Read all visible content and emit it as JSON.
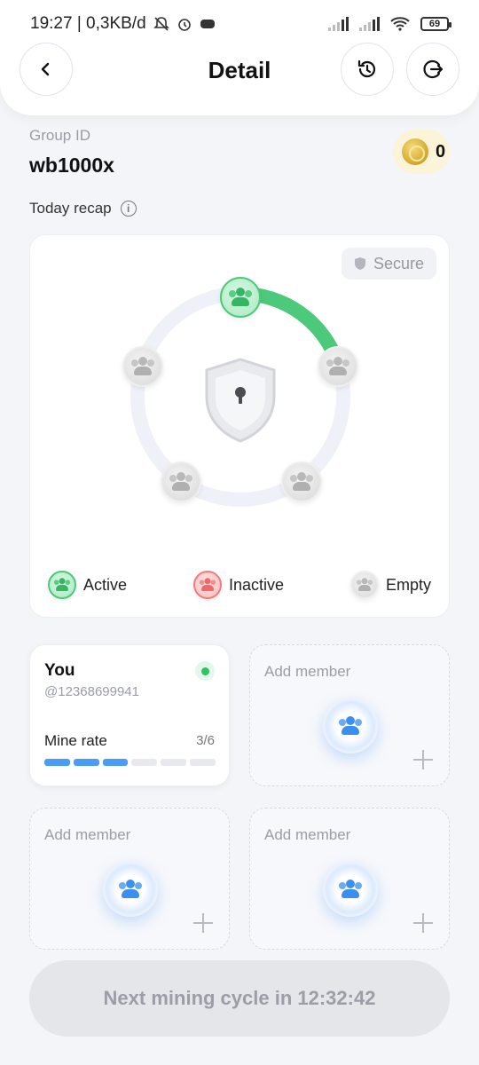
{
  "status_bar": {
    "time_net": "19:27 | 0,3KB/d",
    "battery": "69"
  },
  "header": {
    "title": "Detail",
    "back_icon": "chevron-left-icon",
    "history_icon": "history-icon",
    "exit_icon": "exit-icon"
  },
  "group": {
    "label": "Group ID",
    "id": "wb1000x",
    "coin_count": "0"
  },
  "recap": {
    "label": "Today recap",
    "secure_label": "Secure",
    "active_progress": 0.2,
    "legend": {
      "active": "Active",
      "inactive": "Inactive",
      "empty": "Empty"
    },
    "colors": {
      "active": "#4cc97a",
      "inactive": "#ef7d7d",
      "empty": "#d8d8d8",
      "ring": "#eef2f8"
    }
  },
  "you": {
    "name": "You",
    "handle": "@12368699941",
    "mine_label": "Mine rate",
    "mine_value": "3/6",
    "mine_filled": 3,
    "mine_total": 6
  },
  "members": {
    "add_label": "Add member"
  },
  "cycle": {
    "label": "Next mining cycle in 12:32:42"
  }
}
